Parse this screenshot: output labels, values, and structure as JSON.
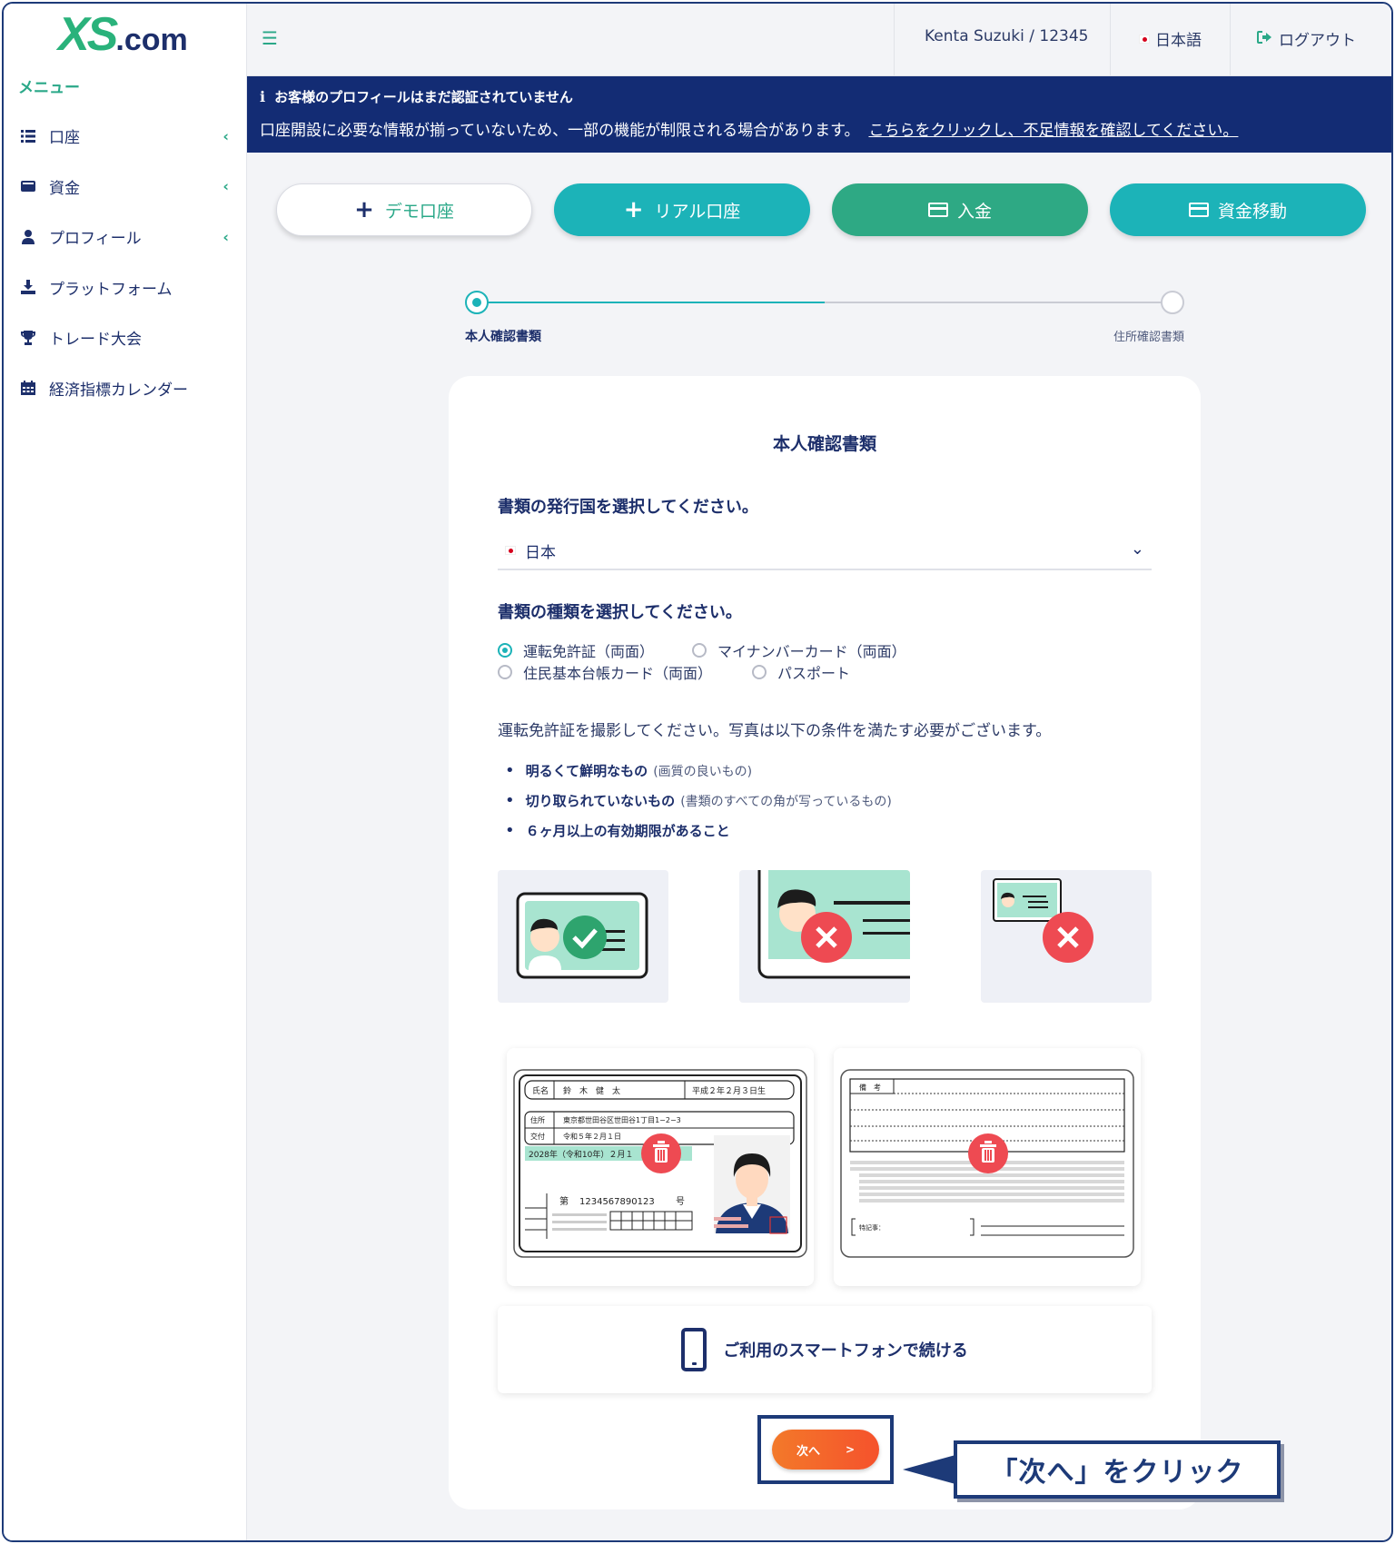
{
  "brand": {
    "logo_main": "XS",
    "logo_suffix": ".com"
  },
  "sidebar": {
    "menu_title": "メニュー",
    "items": [
      {
        "label": "口座",
        "icon": "list-icon",
        "has_chevron": true
      },
      {
        "label": "資金",
        "icon": "wallet-icon",
        "has_chevron": true
      },
      {
        "label": "プロフィール",
        "icon": "user-icon",
        "has_chevron": true
      },
      {
        "label": "プラットフォーム",
        "icon": "download-icon",
        "has_chevron": false
      },
      {
        "label": "トレード大会",
        "icon": "trophy-icon",
        "has_chevron": false
      },
      {
        "label": "経済指標カレンダー",
        "icon": "calendar-icon",
        "has_chevron": false
      }
    ]
  },
  "topbar": {
    "user": "Kenta Suzuki / 12345",
    "language": "日本語",
    "logout": "ログアウト"
  },
  "alert": {
    "title": "お客様のプロフィールはまだ認証されていません",
    "message": "口座開設に必要な情報が揃っていないため、一部の機能が制限される場合があります。",
    "link": "こちらをクリックし、不足情報を確認してください。"
  },
  "actions": {
    "demo": "デモ口座",
    "real": "リアル口座",
    "deposit": "入金",
    "transfer": "資金移動"
  },
  "stepper": {
    "step1": "本人確認書類",
    "step2": "住所確認書類"
  },
  "form": {
    "title": "本人確認書類",
    "country_question": "書類の発行国を選択してください。",
    "country_value": "日本",
    "type_question": "書類の種類を選択してください。",
    "doc_types": {
      "license": "運転免許証（両面）",
      "mynumber": "マイナンバーカード（両面）",
      "resident": "住民基本台帳カード（両面）",
      "passport": "パスポート"
    },
    "selected_type": "license",
    "instruction": "運転免許証を撮影してください。写真は以下の条件を満たす必要がございます。",
    "conditions": [
      {
        "bold": "明るくて鮮明なもの",
        "note": "(画質の良いもの)"
      },
      {
        "bold": "切り取られていないもの",
        "note": "(書類のすべての角が写っているもの)"
      },
      {
        "bold": "６ヶ月以上の有効期限があること",
        "note": ""
      }
    ],
    "license_front": {
      "name_label": "氏名",
      "name": "鈴　木　健　太",
      "birth": "平成２年２月３日生",
      "address_label": "住所",
      "address": "東京都世田谷区世田谷1丁目1−2−3",
      "issued_label": "交付",
      "issued": "令和５年２月１日",
      "expiry": "2028年（令和10年）２月１",
      "number_prefix": "第",
      "number": "1234567890123",
      "number_suffix": "号"
    },
    "license_back": {
      "remarks_label": "備　考",
      "special_label": "特記事："
    },
    "smartphone_button": "ご利用のスマートフォンで続ける",
    "next_button": "次へ",
    "next_arrow": ">"
  },
  "callout": {
    "text": "「次へ」をクリック"
  },
  "colors": {
    "navy": "#1d2f6b",
    "teal": "#1cb3b8",
    "green": "#2ea984",
    "alert_bg": "#132c74",
    "next_orange": "#f5622b",
    "delete_red": "#ee4a52"
  }
}
